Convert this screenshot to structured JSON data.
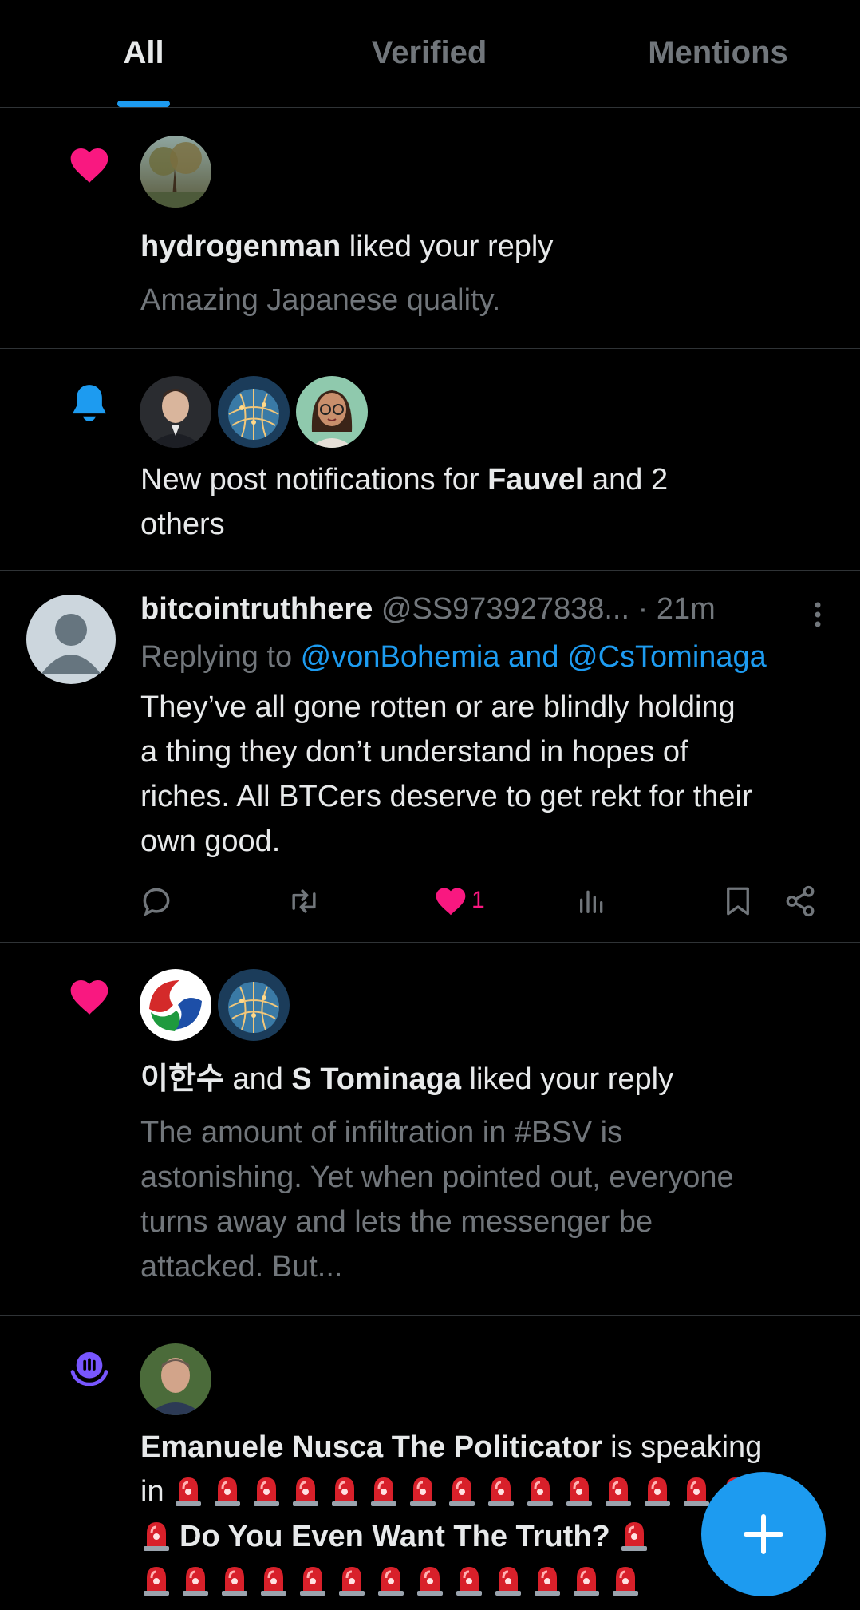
{
  "tabs": [
    {
      "label": "All"
    },
    {
      "label": "Verified"
    },
    {
      "label": "Mentions"
    }
  ],
  "notif1": {
    "user": "hydrogenman",
    "action": " liked your reply",
    "snippet": "Amazing Japanese quality."
  },
  "notif2": {
    "prefix": "New post notifications for ",
    "user": "Fauvel",
    "suffix": " and 2",
    "line2": "others"
  },
  "post": {
    "name": "bitcointruthhere",
    "handle": "@SS973927838...",
    "time": "· 21m",
    "replying_prefix": "Replying to ",
    "replying_to": "@vonBohemia and @CsTominaga",
    "text_lines": [
      "They’ve all gone rotten or are blindly holding",
      "a thing they don’t understand in hopes of",
      "riches. All BTCers deserve to get rekt for their",
      "own good."
    ],
    "like_count": "1"
  },
  "notif4": {
    "user1": "이한수",
    "and": " and ",
    "user2": "S Tominaga",
    "action": " liked your reply",
    "snippet_lines": [
      "The amount of infiltration in #BSV is",
      "astonishing. Yet when pointed out, everyone",
      "turns away and lets the messenger be",
      "attacked. But..."
    ]
  },
  "notif5": {
    "user": "Emanuele Nusca The Politicator",
    "action": " is speaking",
    "in_word": "in",
    "space_title": "Do You Even Want The Truth?"
  },
  "colors": {
    "background": "#000000",
    "accent": "#1d9bf0",
    "like": "#f91880",
    "spaces": "#7856ff",
    "muted": "#71767b",
    "text": "#e7e9ea"
  },
  "icons": [
    "heart-icon",
    "bell-icon",
    "reply-icon",
    "retweet-icon",
    "views-icon",
    "bookmark-icon",
    "share-icon",
    "more-icon",
    "spaces-icon",
    "siren-emoji",
    "plus-icon"
  ]
}
